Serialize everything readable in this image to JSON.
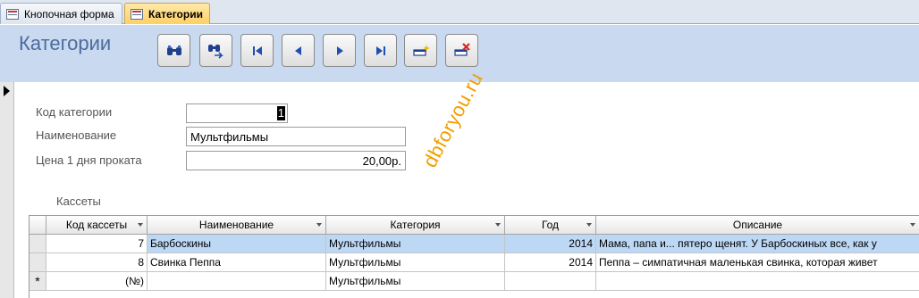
{
  "tabs": [
    {
      "label": "Кнопочная форма",
      "active": false
    },
    {
      "label": "Категории",
      "active": true
    }
  ],
  "header": {
    "title": "Категории"
  },
  "toolbar": {
    "buttons": [
      "find-icon",
      "find-next-icon",
      "first-record-icon",
      "previous-record-icon",
      "next-record-icon",
      "last-record-icon",
      "new-record-icon",
      "delete-record-icon"
    ]
  },
  "form": {
    "code_label": "Код категории",
    "code_value": "1",
    "name_label": "Наименование",
    "name_value": "Мультфильмы",
    "price_label": "Цена 1 дня проката",
    "price_value": "20,00р."
  },
  "watermark": "dbforyou.ru",
  "subform": {
    "caption": "Кассеты",
    "columns": [
      "Код кассеты",
      "Наименование",
      "Категория",
      "Год",
      "Описание"
    ],
    "rows": [
      {
        "code": "7",
        "name": "Барбоскины",
        "category": "Мультфильмы",
        "year": "2014",
        "desc": "Мама, папа и... пятеро щенят. У Барбоскиных все, как у"
      },
      {
        "code": "8",
        "name": "Свинка Пеппа",
        "category": "Мультфильмы",
        "year": "2014",
        "desc": "Пеппа – симпатичная маленькая свинка, которая живет"
      }
    ],
    "new_row": {
      "marker": "*",
      "code": "(№)",
      "category": "Мультфильмы"
    }
  },
  "colors": {
    "accent": "#4e6b9f",
    "header_bg": "#c9d9ef",
    "active_tab": "#ffcf63",
    "watermark": "#f0a000",
    "selected_row": "#bdd8f5"
  }
}
